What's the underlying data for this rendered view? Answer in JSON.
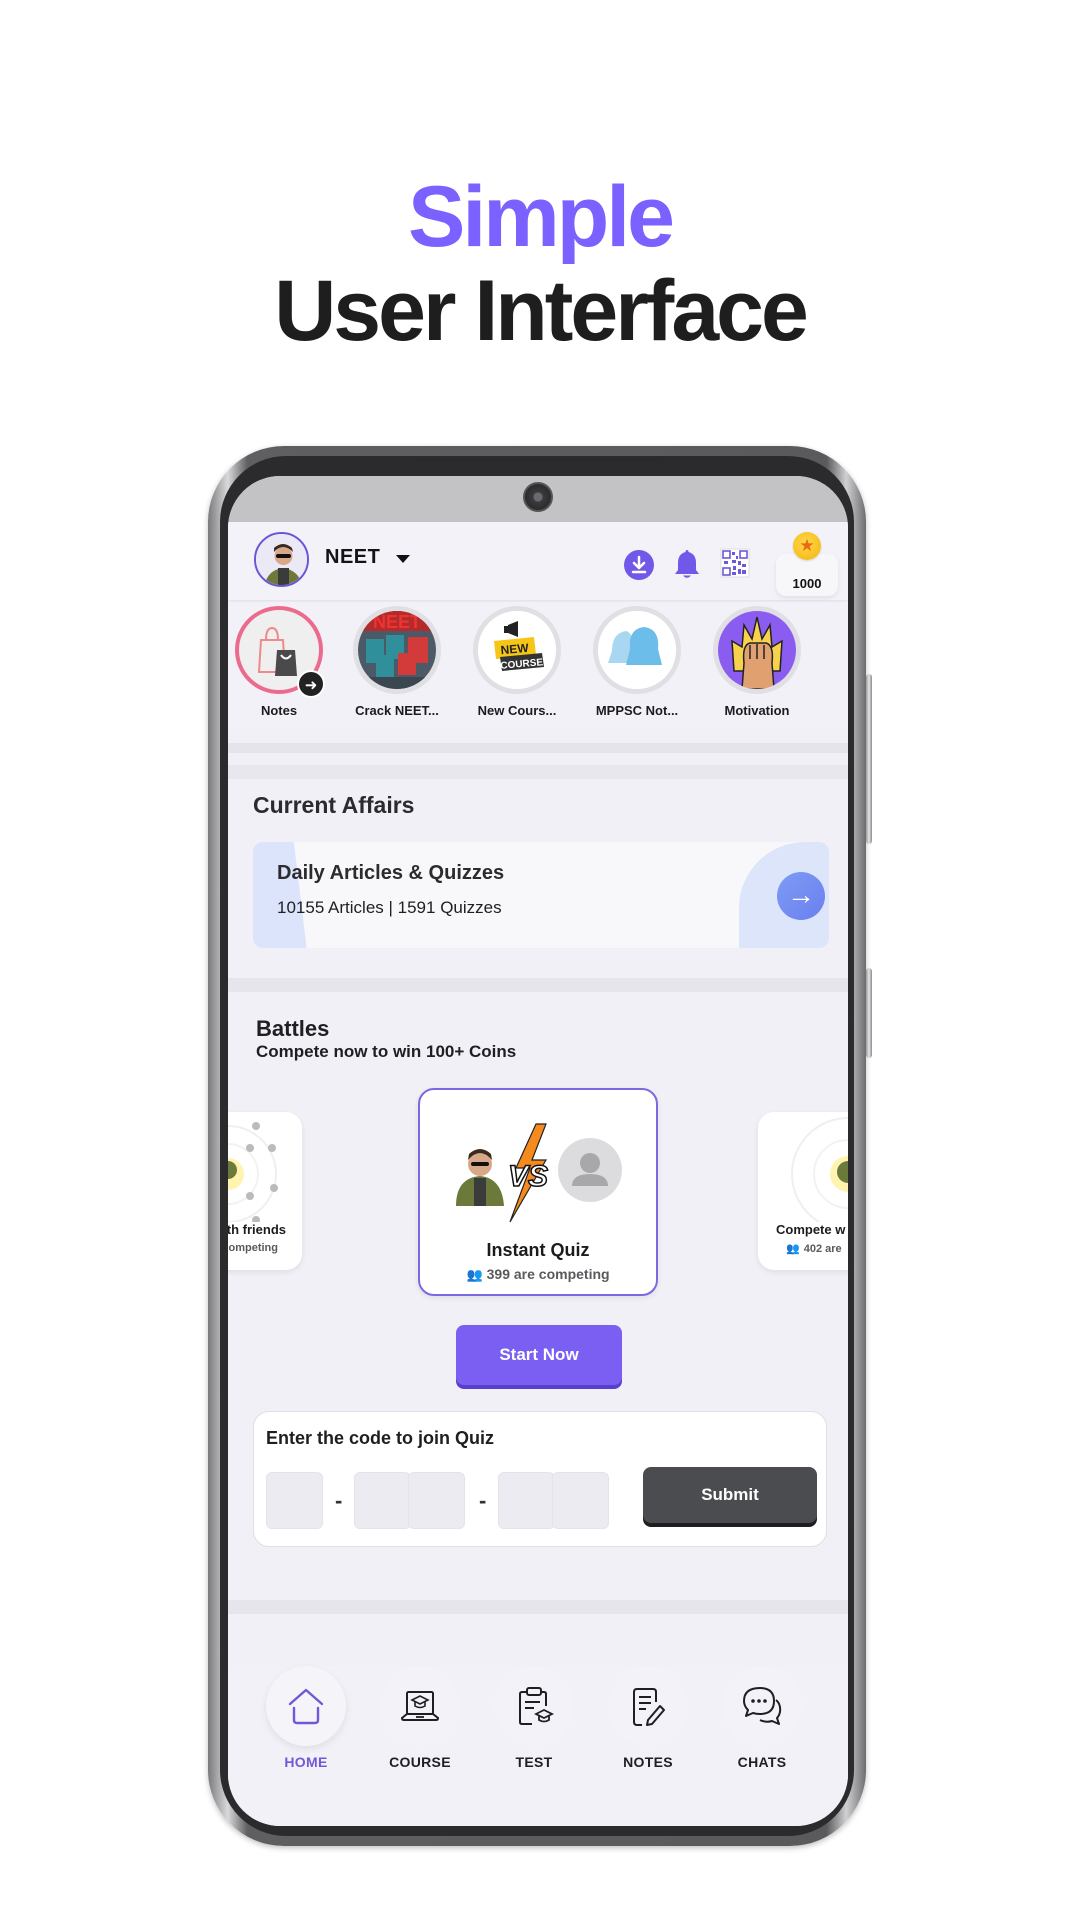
{
  "hero": {
    "line1": "Simple",
    "line2": "User Interface"
  },
  "colors": {
    "accent": "#7b61ff",
    "home_active": "#7258d6",
    "submit_dark": "#4b4c4f"
  },
  "header": {
    "exam": "NEET",
    "dropdown_icon": "caret-down-icon",
    "icons": [
      "download-icon",
      "bell-icon",
      "qr-code-icon"
    ],
    "coins": "1000"
  },
  "stories": [
    {
      "label": "Notes",
      "icon": "shopping-bag-icon",
      "active": true
    },
    {
      "label": "Crack NEET...",
      "icon": "neet-course-thumbnail"
    },
    {
      "label": "New Cours...",
      "icon": "new-course-megaphone-icon"
    },
    {
      "label": "MPPSC Not...",
      "icon": "bells-icon"
    },
    {
      "label": "Motivation",
      "icon": "fist-icon"
    }
  ],
  "current_affairs": {
    "title": "Current Affairs",
    "card_title": "Daily Articles & Quizzes",
    "card_sub": "10155 Articles | 1591 Quizzes"
  },
  "battles": {
    "title": "Battles",
    "subtitle": "Compete now to win 100+ Coins",
    "cards": [
      {
        "title": "with friends",
        "sub": "competing"
      },
      {
        "title": "Instant Quiz",
        "sub": "399 are competing",
        "vs": "VS"
      },
      {
        "title": "Compete w",
        "sub": "402 are"
      }
    ],
    "start_label": "Start Now"
  },
  "join": {
    "label": "Enter the code to join Quiz",
    "dash": "-",
    "submit_label": "Submit"
  },
  "nav": [
    {
      "label": "HOME",
      "active": true
    },
    {
      "label": "COURSE"
    },
    {
      "label": "TEST"
    },
    {
      "label": "NOTES"
    },
    {
      "label": "CHATS"
    }
  ]
}
